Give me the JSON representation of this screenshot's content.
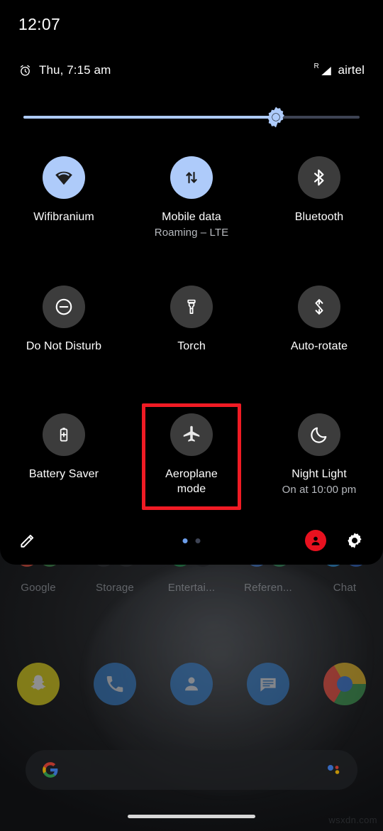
{
  "status_bar": {
    "clock": "12:07"
  },
  "quick_settings": {
    "header": {
      "alarm_icon": "alarm-clock-icon",
      "alarm_text": "Thu, 7:15 am",
      "roaming_indicator": "R",
      "signal_icon": "signal-bars-icon",
      "carrier": "airtel"
    },
    "brightness": {
      "label": "Brightness",
      "icon": "brightness-sun-icon",
      "value_percent": 75,
      "fill_color": "#aecbfa",
      "track_color": "#3d4353"
    },
    "tiles": [
      {
        "label": "Wifibranium",
        "sub": "",
        "icon": "wifi-icon",
        "state": "on",
        "highlighted": false
      },
      {
        "label": "Mobile data",
        "sub": "Roaming – LTE",
        "icon": "mobile-data-icon",
        "state": "on",
        "highlighted": false
      },
      {
        "label": "Bluetooth",
        "sub": "",
        "icon": "bluetooth-icon",
        "state": "off",
        "highlighted": false
      },
      {
        "label": "Do Not Disturb",
        "sub": "",
        "icon": "do-not-disturb-icon",
        "state": "off",
        "highlighted": false
      },
      {
        "label": "Torch",
        "sub": "",
        "icon": "flashlight-icon",
        "state": "off",
        "highlighted": false
      },
      {
        "label": "Auto-rotate",
        "sub": "",
        "icon": "auto-rotate-icon",
        "state": "off",
        "highlighted": false
      },
      {
        "label": "Battery Saver",
        "sub": "",
        "icon": "battery-saver-icon",
        "state": "off",
        "highlighted": false
      },
      {
        "label": "Aeroplane mode",
        "sub": "",
        "icon": "airplane-icon",
        "state": "off",
        "highlighted": true
      },
      {
        "label": "Night Light",
        "sub": "On at 10:00 pm",
        "icon": "moon-icon",
        "state": "off",
        "highlighted": false
      }
    ],
    "highlight_color": "#f01b24",
    "footer": {
      "edit_icon": "pencil-edit-icon",
      "pages": {
        "count": 2,
        "active_index": 0
      },
      "user_icon": "user-avatar-icon",
      "settings_icon": "gear-settings-icon"
    },
    "active_tile_color": "#aecbfa",
    "inactive_tile_color": "#3c3c3c"
  },
  "home_screen": {
    "folders": [
      {
        "label": "Google"
      },
      {
        "label": "Storage"
      },
      {
        "label": "Entertai..."
      },
      {
        "label": "Referen..."
      },
      {
        "label": "Chat"
      }
    ],
    "dock": [
      {
        "name": "Snapchat"
      },
      {
        "name": "Phone"
      },
      {
        "name": "Contacts"
      },
      {
        "name": "Messages"
      },
      {
        "name": "Chrome"
      }
    ],
    "search_bar": {
      "google_icon": "google-g-icon",
      "assistant_icon": "google-assistant-icon",
      "text": ""
    },
    "gesture_bar": "home-gesture-pill"
  },
  "watermark": {
    "text": "wsxdn.com"
  }
}
